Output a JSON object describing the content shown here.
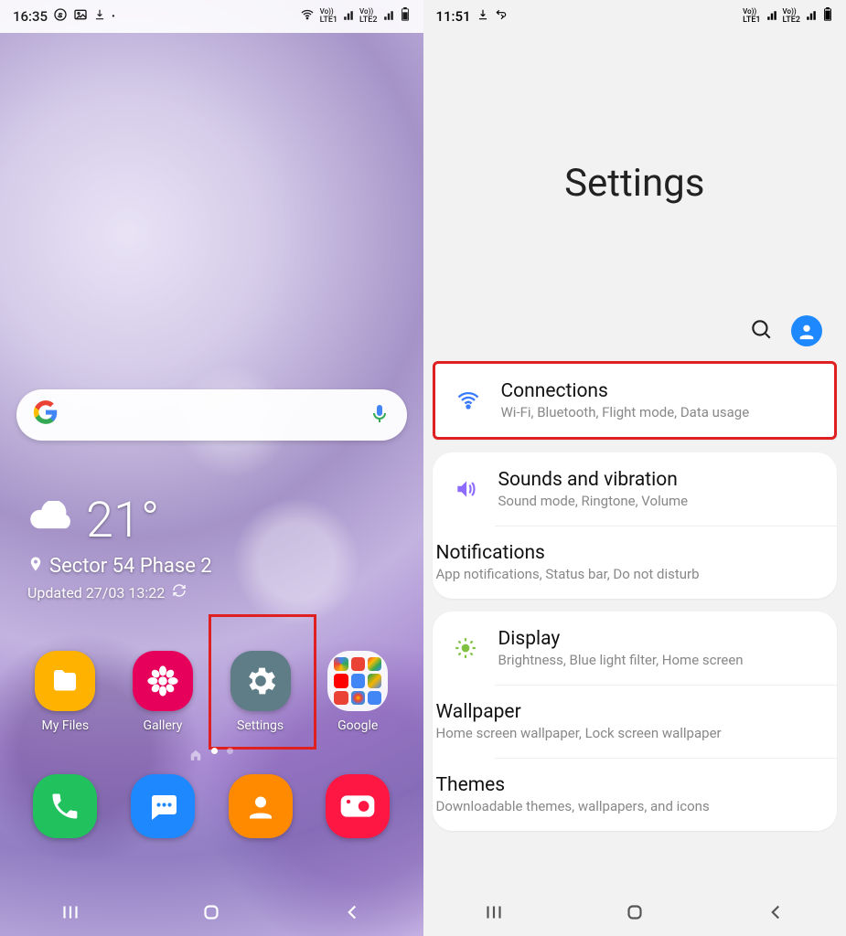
{
  "left": {
    "status": {
      "time": "16:35",
      "lte1": "LTE1",
      "lte2": "LTE2"
    },
    "weather": {
      "temp": "21°",
      "location": "Sector 54 Phase 2",
      "updated": "Updated 27/03 13:22"
    },
    "apps": [
      {
        "label": "My Files",
        "color": "#ffb300",
        "icon": "folder"
      },
      {
        "label": "Gallery",
        "color": "#e6005c",
        "icon": "flower"
      },
      {
        "label": "Settings",
        "color": "#5f7d86",
        "icon": "gear",
        "highlighted": true
      },
      {
        "label": "Google",
        "icon": "folder-google"
      }
    ],
    "dock": [
      {
        "color": "#21c15e",
        "icon": "phone"
      },
      {
        "color": "#1e88ff",
        "icon": "messages"
      },
      {
        "color": "#ff8a00",
        "icon": "contacts"
      },
      {
        "color": "#ff1744",
        "icon": "camera"
      }
    ]
  },
  "right": {
    "status": {
      "time": "11:51",
      "lte1": "LTE1",
      "lte2": "LTE2"
    },
    "title": "Settings",
    "groups": [
      {
        "highlighted": true,
        "rows": [
          {
            "icon": "wifi",
            "iconColor": "#3a7bff",
            "title": "Connections",
            "sub": "Wi-Fi, Bluetooth, Flight mode, Data usage"
          }
        ]
      },
      {
        "rows": [
          {
            "icon": "sound",
            "iconColor": "#8e6bff",
            "title": "Sounds and vibration",
            "sub": "Sound mode, Ringtone, Volume"
          },
          {
            "icon": "notifications",
            "iconColor": "#ff6b6b",
            "title": "Notifications",
            "sub": "App notifications, Status bar, Do not disturb"
          }
        ]
      },
      {
        "rows": [
          {
            "icon": "display",
            "iconColor": "#7fc241",
            "title": "Display",
            "sub": "Brightness, Blue light filter, Home screen"
          },
          {
            "icon": "wallpaper",
            "iconColor": "#ff5da2",
            "title": "Wallpaper",
            "sub": "Home screen wallpaper, Lock screen wallpaper"
          },
          {
            "icon": "themes",
            "iconColor": "#8e6bff",
            "title": "Themes",
            "sub": "Downloadable themes, wallpapers, and icons"
          }
        ]
      }
    ]
  }
}
